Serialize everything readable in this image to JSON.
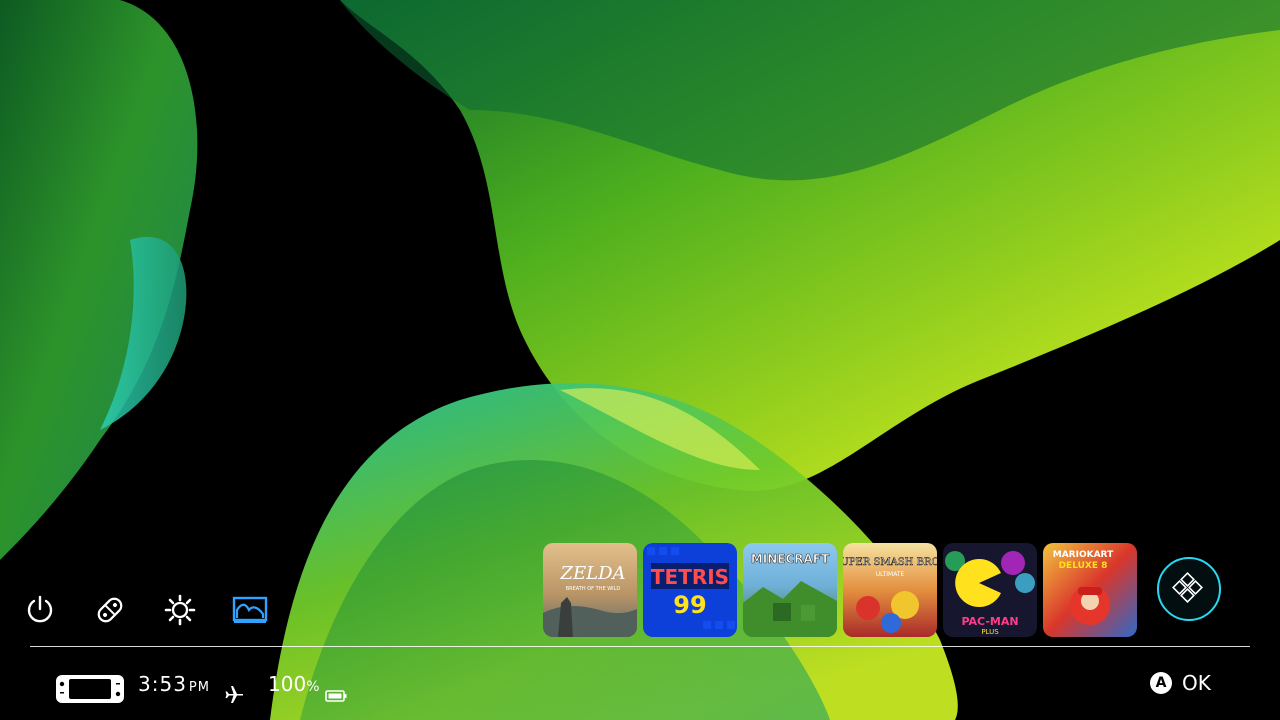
{
  "wallpaper": {
    "colors": [
      "#0f7a2a",
      "#57c11b",
      "#d9f523",
      "#2fd6a6",
      "#000000"
    ]
  },
  "quick_menu": [
    {
      "name": "power-icon",
      "label": "Power"
    },
    {
      "name": "controllers-icon",
      "label": "Controllers"
    },
    {
      "name": "settings-icon",
      "label": "System Settings"
    },
    {
      "name": "album-icon",
      "label": "Album",
      "active": true
    }
  ],
  "games": [
    {
      "id": "zelda",
      "title": "ZELDA",
      "subtitle": "BREATH OF THE WILD",
      "colors": [
        "#d9b37a",
        "#5b6d6d"
      ]
    },
    {
      "id": "tetris99",
      "title": "TETRIS",
      "subtitle": "99",
      "colors": [
        "#1249e6",
        "#0a2fb5"
      ]
    },
    {
      "id": "minecraft",
      "title": "MINECRAFT",
      "subtitle": "",
      "colors": [
        "#7ac0e8",
        "#3f8d2b"
      ]
    },
    {
      "id": "smash",
      "title": "SUPER SMASH BROS",
      "subtitle": "ULTIMATE",
      "colors": [
        "#f1d27a",
        "#c2332b"
      ]
    },
    {
      "id": "pacman",
      "title": "PAC-MAN",
      "subtitle": "PLUS",
      "colors": [
        "#1d1d3a",
        "#c42bd8"
      ]
    },
    {
      "id": "mariokart",
      "title": "MARIOKART",
      "subtitle": "DELUXE 8",
      "colors": [
        "#e6362b",
        "#2f69c7"
      ]
    }
  ],
  "all_software_button": {
    "label": "All Software",
    "accent": "#29d7ee"
  },
  "status_bar": {
    "time": "3:53",
    "ampm": "PM",
    "battery_value": "100",
    "battery_unit": "%",
    "airplane_mode": true
  },
  "hint": {
    "button": "A",
    "label": "OK"
  }
}
